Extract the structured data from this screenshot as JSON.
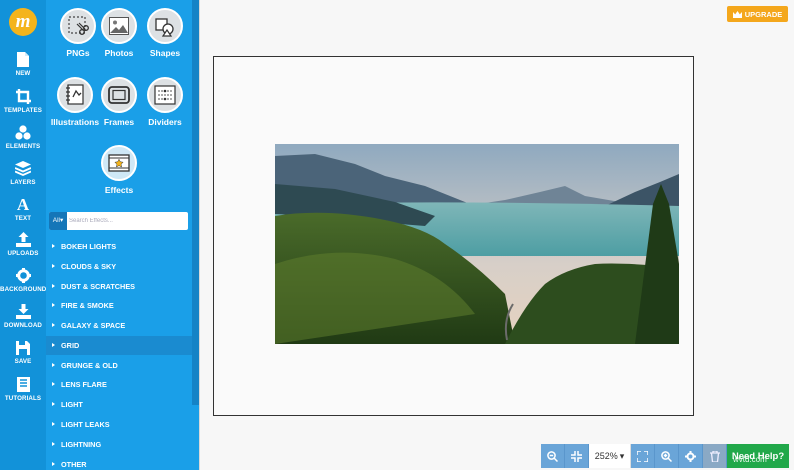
{
  "rail": {
    "logo": "m",
    "items": [
      {
        "id": "new",
        "label": "NEW",
        "icon": "file-icon"
      },
      {
        "id": "templates",
        "label": "TEMPLATES",
        "icon": "crop-frame-icon"
      },
      {
        "id": "elements",
        "label": "ELEMENTS",
        "icon": "cubes-icon"
      },
      {
        "id": "layers",
        "label": "LAYERS",
        "icon": "layers-icon"
      },
      {
        "id": "text",
        "label": "TEXT",
        "icon": "text-a-icon"
      },
      {
        "id": "uploads",
        "label": "UPLOADS",
        "icon": "upload-icon"
      },
      {
        "id": "background",
        "label": "BACKGROUND",
        "icon": "gear-icon"
      },
      {
        "id": "download",
        "label": "DOWNLOAD",
        "icon": "download-icon"
      },
      {
        "id": "save",
        "label": "SAVE",
        "icon": "floppy-icon"
      },
      {
        "id": "tutorials",
        "label": "TUTORIALS",
        "icon": "book-icon"
      }
    ]
  },
  "panel": {
    "tiles": [
      "PNGs",
      "Photos",
      "Shapes",
      "Illustrations",
      "Frames",
      "Dividers",
      "Effects"
    ],
    "filter": {
      "scope": "All",
      "placeholder": "Search Effects..."
    },
    "categories": [
      "BOKEH LIGHTS",
      "CLOUDS & SKY",
      "DUST & SCRATCHES",
      "FIRE & SMOKE",
      "GALAXY & SPACE",
      "GRID",
      "GRUNGE & OLD",
      "LENS FLARE",
      "LIGHT",
      "LIGHT LEAKS",
      "LIGHTNING",
      "OTHER"
    ],
    "active_category": "GRID"
  },
  "header": {
    "upgrade_label": "UPGRADE"
  },
  "toolbar": {
    "zoom": "252%",
    "help_label": "Need Help?"
  },
  "watermark": "wvtd.com",
  "colors": {
    "rail": "#1292d9",
    "panel": "#1a9fe8",
    "upgrade": "#f4a71c",
    "help": "#21a84a"
  }
}
